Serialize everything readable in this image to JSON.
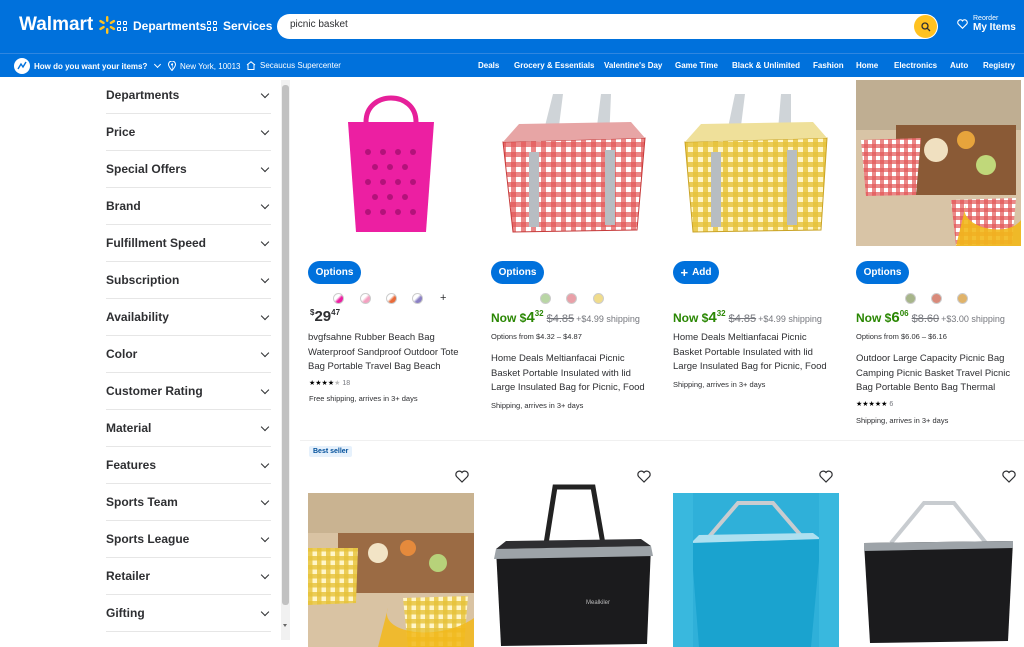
{
  "header": {
    "logo": "Walmart",
    "departments": "Departments",
    "services": "Services",
    "search_value": "picnic basket",
    "reorder_small": "Reorder",
    "reorder_big": "My Items"
  },
  "subbar": {
    "question": "How do you want your items?",
    "location": "New York, 10013",
    "store": "Secaucus Supercenter",
    "nav": [
      "Deals",
      "Grocery & Essentials",
      "Valentine's Day",
      "Game Time",
      "Black & Unlimited",
      "Fashion",
      "Home",
      "Electronics",
      "Auto",
      "Registry"
    ]
  },
  "filters": [
    "Departments",
    "Price",
    "Special Offers",
    "Brand",
    "Fulfillment Speed",
    "Subscription",
    "Availability",
    "Color",
    "Customer Rating",
    "Material",
    "Features",
    "Sports Team",
    "Sports League",
    "Retailer",
    "Gifting"
  ],
  "products": [
    {
      "button": "Options",
      "price_dollars": "29",
      "price_cents": "47",
      "more_swatches": "+",
      "title": "bvgfsahne Rubber Beach Bag Waterproof Sandproof Outdoor Tote Bag Portable Travel Bag Beach Sports...",
      "rating_count": "18",
      "fulfillment": "Free shipping, arrives in 3+ days"
    },
    {
      "button": "Options",
      "now": "Now $",
      "price_dollars": "4",
      "price_cents": "32",
      "was": "$4.85",
      "shipping": "+$4.99 shipping",
      "options_from": "Options from $4.32 – $4.87",
      "title": "Home Deals Meltianfacai Picnic Basket Portable Insulated with lid Large Insulated Bag for Picnic, Food Delivery...",
      "fulfillment": "Shipping, arrives in 3+ days"
    },
    {
      "button": "Add",
      "now": "Now $",
      "price_dollars": "4",
      "price_cents": "32",
      "was": "$4.85",
      "shipping": "+$4.99 shipping",
      "title": "Home Deals Meltianfacai Picnic Basket Portable Insulated with lid Large Insulated Bag for Picnic, Food Delivery...",
      "fulfillment": "Shipping, arrives in 3+ days"
    },
    {
      "button": "Options",
      "now": "Now $",
      "price_dollars": "6",
      "price_cents": "06",
      "was": "$8.60",
      "shipping": "+$3.00 shipping",
      "options_from": "Options from $6.06 – $6.16",
      "title": "Outdoor Large Capacity Picnic Bag Camping Picnic Basket Travel Picnic Bag Portable Bento Bag Thermal Insulation...",
      "rating_count": "6",
      "fulfillment": "Shipping, arrives in 3+ days"
    }
  ],
  "badge": "Best seller",
  "colors": {
    "brand_blue": "#0071dc",
    "spark_yellow": "#ffc220",
    "price_green": "#2a8703"
  },
  "icons": [
    "spark-icon",
    "grid-icon",
    "search-icon",
    "reorder-heart-icon",
    "location-pin-icon",
    "store-icon",
    "chevron-down-icon",
    "heart-icon",
    "plus-icon"
  ]
}
